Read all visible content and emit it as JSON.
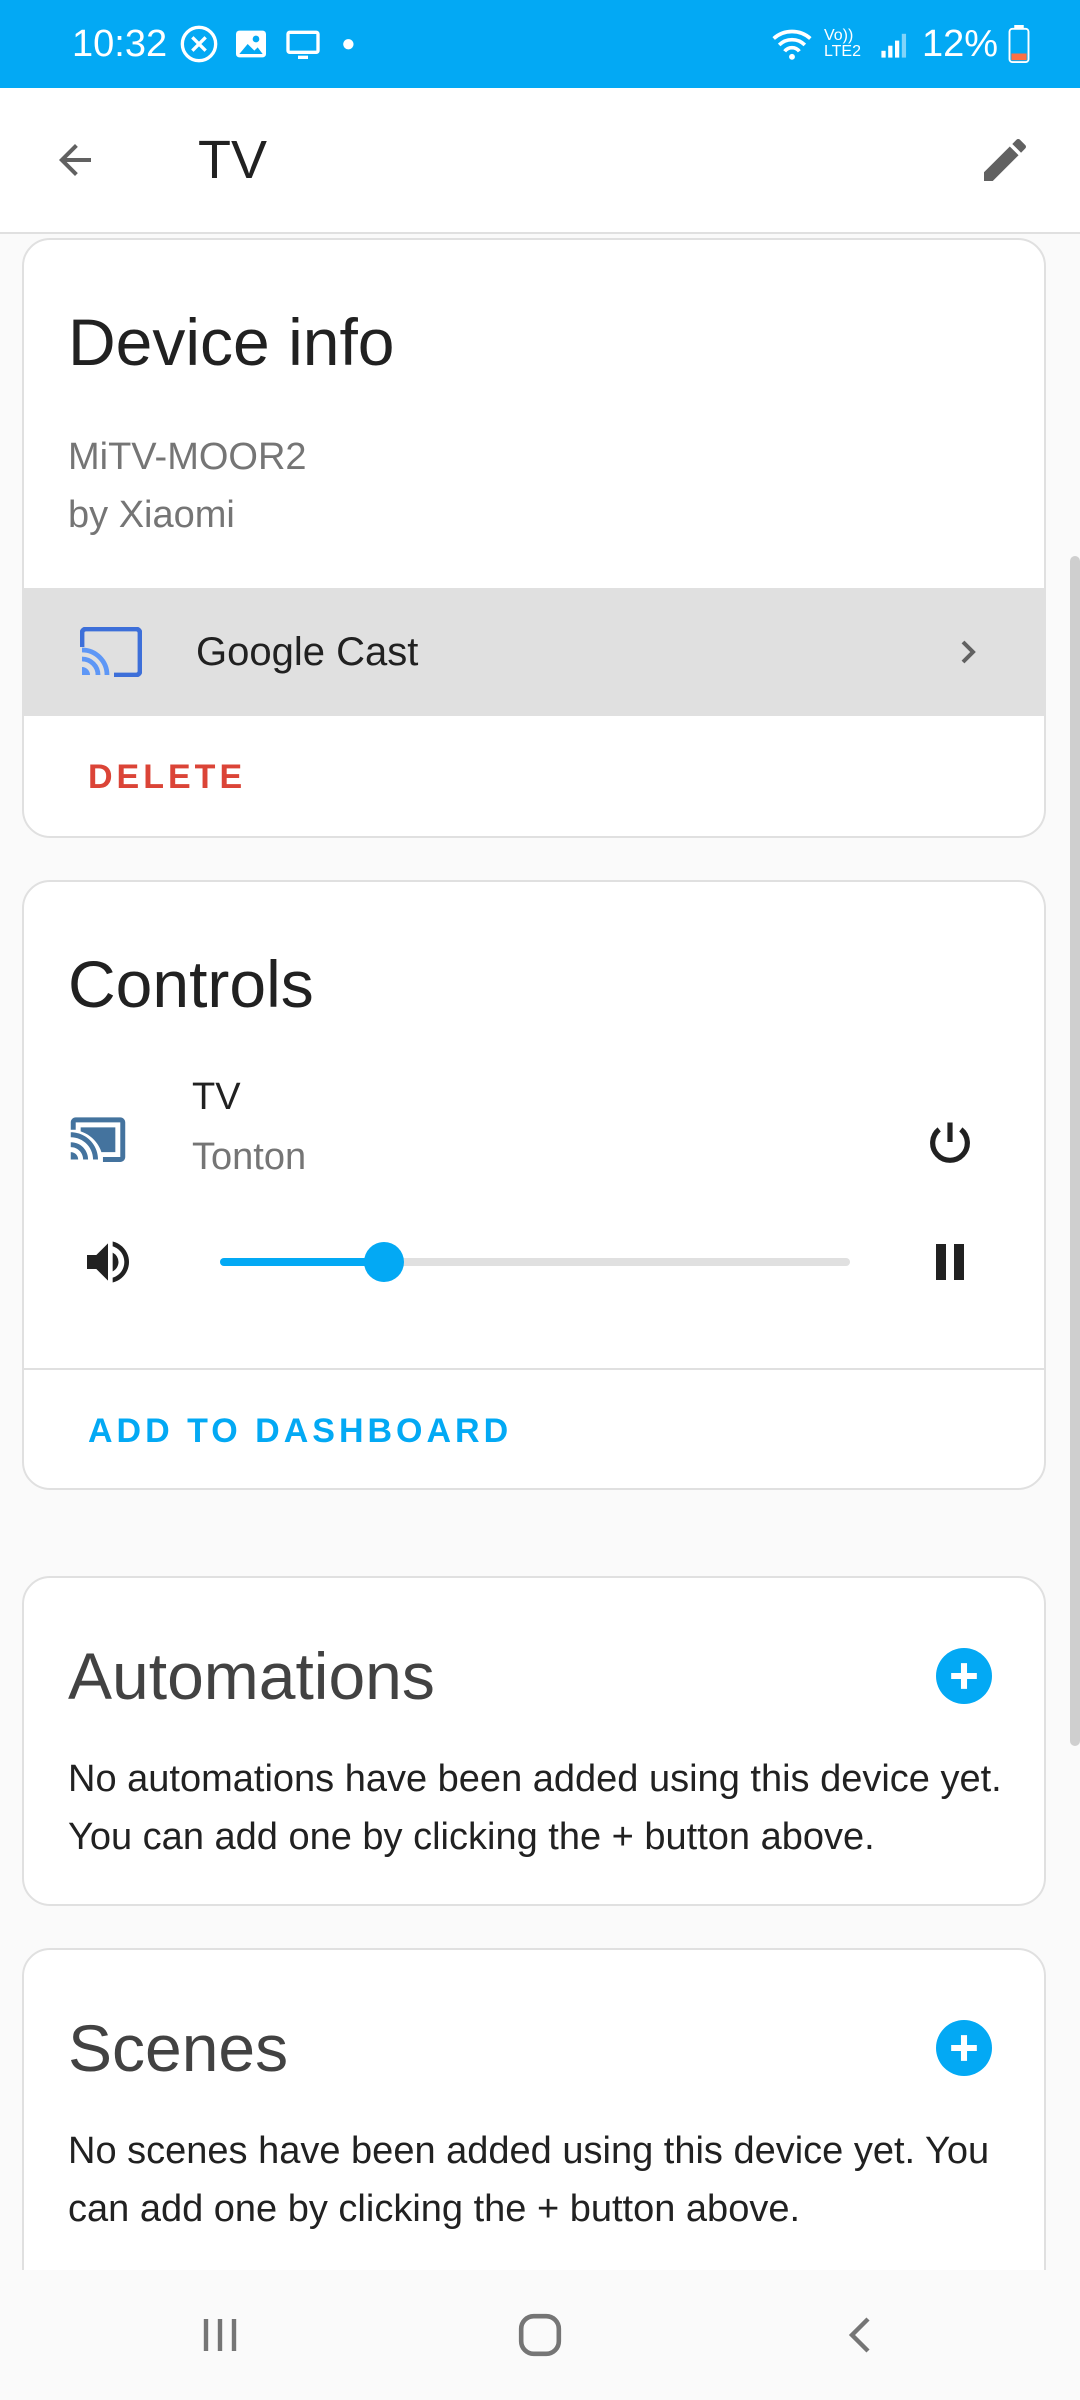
{
  "status_bar": {
    "time": "10:32",
    "battery": "12%",
    "network_label": "Vo)) LTE2",
    "icons": [
      "blocked-icon",
      "image-icon",
      "screen-icon",
      "dot-icon",
      "wifi-icon",
      "signal-icon",
      "battery-icon"
    ]
  },
  "app_bar": {
    "title": "TV",
    "back_icon": "arrow-left-icon",
    "edit_icon": "pencil-icon"
  },
  "device_info": {
    "title": "Device info",
    "model": "MiTV-MOOR2",
    "manufacturer": "by Xiaomi",
    "integration": {
      "label": "Google Cast",
      "icon": "cast-icon"
    },
    "delete_label": "DELETE"
  },
  "controls": {
    "title": "Controls",
    "entity": {
      "name": "TV",
      "state": "Tonton",
      "icon": "cast-connected-icon"
    },
    "volume_level": 0.26,
    "add_to_dashboard_label": "ADD TO DASHBOARD"
  },
  "automations": {
    "title": "Automations",
    "empty_message": "No automations have been added using this device yet. You can add one by clicking the + button above."
  },
  "scenes": {
    "title": "Scenes",
    "empty_message": "No scenes have been added using this device yet. You can add one by clicking the + button above."
  },
  "colors": {
    "primary": "#03a9f4",
    "delete": "#db4437",
    "highlight_row": "#e0e0e0"
  }
}
